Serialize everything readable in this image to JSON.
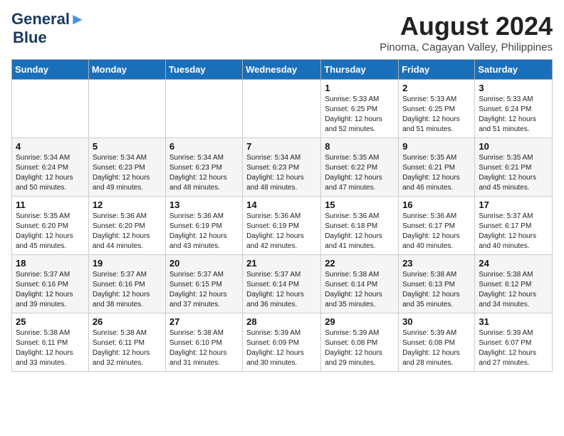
{
  "header": {
    "logo_line1": "General",
    "logo_line2": "Blue",
    "month": "August 2024",
    "location": "Pinoma, Cagayan Valley, Philippines"
  },
  "days_of_week": [
    "Sunday",
    "Monday",
    "Tuesday",
    "Wednesday",
    "Thursday",
    "Friday",
    "Saturday"
  ],
  "weeks": [
    [
      {
        "day": "",
        "info": ""
      },
      {
        "day": "",
        "info": ""
      },
      {
        "day": "",
        "info": ""
      },
      {
        "day": "",
        "info": ""
      },
      {
        "day": "1",
        "info": "Sunrise: 5:33 AM\nSunset: 6:25 PM\nDaylight: 12 hours\nand 52 minutes."
      },
      {
        "day": "2",
        "info": "Sunrise: 5:33 AM\nSunset: 6:25 PM\nDaylight: 12 hours\nand 51 minutes."
      },
      {
        "day": "3",
        "info": "Sunrise: 5:33 AM\nSunset: 6:24 PM\nDaylight: 12 hours\nand 51 minutes."
      }
    ],
    [
      {
        "day": "4",
        "info": "Sunrise: 5:34 AM\nSunset: 6:24 PM\nDaylight: 12 hours\nand 50 minutes."
      },
      {
        "day": "5",
        "info": "Sunrise: 5:34 AM\nSunset: 6:23 PM\nDaylight: 12 hours\nand 49 minutes."
      },
      {
        "day": "6",
        "info": "Sunrise: 5:34 AM\nSunset: 6:23 PM\nDaylight: 12 hours\nand 48 minutes."
      },
      {
        "day": "7",
        "info": "Sunrise: 5:34 AM\nSunset: 6:23 PM\nDaylight: 12 hours\nand 48 minutes."
      },
      {
        "day": "8",
        "info": "Sunrise: 5:35 AM\nSunset: 6:22 PM\nDaylight: 12 hours\nand 47 minutes."
      },
      {
        "day": "9",
        "info": "Sunrise: 5:35 AM\nSunset: 6:21 PM\nDaylight: 12 hours\nand 46 minutes."
      },
      {
        "day": "10",
        "info": "Sunrise: 5:35 AM\nSunset: 6:21 PM\nDaylight: 12 hours\nand 45 minutes."
      }
    ],
    [
      {
        "day": "11",
        "info": "Sunrise: 5:35 AM\nSunset: 6:20 PM\nDaylight: 12 hours\nand 45 minutes."
      },
      {
        "day": "12",
        "info": "Sunrise: 5:36 AM\nSunset: 6:20 PM\nDaylight: 12 hours\nand 44 minutes."
      },
      {
        "day": "13",
        "info": "Sunrise: 5:36 AM\nSunset: 6:19 PM\nDaylight: 12 hours\nand 43 minutes."
      },
      {
        "day": "14",
        "info": "Sunrise: 5:36 AM\nSunset: 6:19 PM\nDaylight: 12 hours\nand 42 minutes."
      },
      {
        "day": "15",
        "info": "Sunrise: 5:36 AM\nSunset: 6:18 PM\nDaylight: 12 hours\nand 41 minutes."
      },
      {
        "day": "16",
        "info": "Sunrise: 5:36 AM\nSunset: 6:17 PM\nDaylight: 12 hours\nand 40 minutes."
      },
      {
        "day": "17",
        "info": "Sunrise: 5:37 AM\nSunset: 6:17 PM\nDaylight: 12 hours\nand 40 minutes."
      }
    ],
    [
      {
        "day": "18",
        "info": "Sunrise: 5:37 AM\nSunset: 6:16 PM\nDaylight: 12 hours\nand 39 minutes."
      },
      {
        "day": "19",
        "info": "Sunrise: 5:37 AM\nSunset: 6:16 PM\nDaylight: 12 hours\nand 38 minutes."
      },
      {
        "day": "20",
        "info": "Sunrise: 5:37 AM\nSunset: 6:15 PM\nDaylight: 12 hours\nand 37 minutes."
      },
      {
        "day": "21",
        "info": "Sunrise: 5:37 AM\nSunset: 6:14 PM\nDaylight: 12 hours\nand 36 minutes."
      },
      {
        "day": "22",
        "info": "Sunrise: 5:38 AM\nSunset: 6:14 PM\nDaylight: 12 hours\nand 35 minutes."
      },
      {
        "day": "23",
        "info": "Sunrise: 5:38 AM\nSunset: 6:13 PM\nDaylight: 12 hours\nand 35 minutes."
      },
      {
        "day": "24",
        "info": "Sunrise: 5:38 AM\nSunset: 6:12 PM\nDaylight: 12 hours\nand 34 minutes."
      }
    ],
    [
      {
        "day": "25",
        "info": "Sunrise: 5:38 AM\nSunset: 6:11 PM\nDaylight: 12 hours\nand 33 minutes."
      },
      {
        "day": "26",
        "info": "Sunrise: 5:38 AM\nSunset: 6:11 PM\nDaylight: 12 hours\nand 32 minutes."
      },
      {
        "day": "27",
        "info": "Sunrise: 5:38 AM\nSunset: 6:10 PM\nDaylight: 12 hours\nand 31 minutes."
      },
      {
        "day": "28",
        "info": "Sunrise: 5:39 AM\nSunset: 6:09 PM\nDaylight: 12 hours\nand 30 minutes."
      },
      {
        "day": "29",
        "info": "Sunrise: 5:39 AM\nSunset: 6:08 PM\nDaylight: 12 hours\nand 29 minutes."
      },
      {
        "day": "30",
        "info": "Sunrise: 5:39 AM\nSunset: 6:08 PM\nDaylight: 12 hours\nand 28 minutes."
      },
      {
        "day": "31",
        "info": "Sunrise: 5:39 AM\nSunset: 6:07 PM\nDaylight: 12 hours\nand 27 minutes."
      }
    ]
  ]
}
